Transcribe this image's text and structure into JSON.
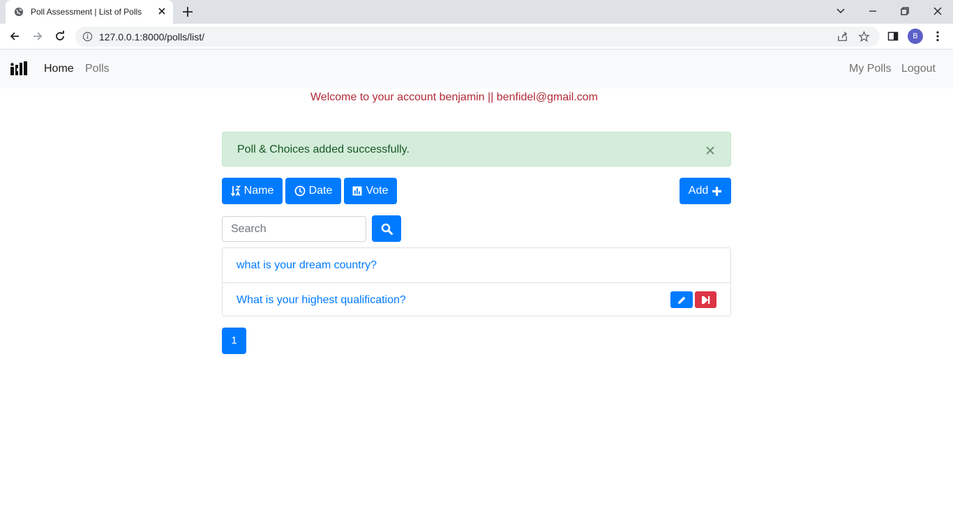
{
  "browser": {
    "tab_title": "Poll Assessment | List of Polls",
    "url": "127.0.0.1:8000/polls/list/",
    "profile_initial": "B"
  },
  "navbar": {
    "brand_icon": "logo-icon",
    "links": {
      "home": "Home",
      "polls": "Polls",
      "my_polls": "My Polls",
      "logout": "Logout"
    }
  },
  "welcome": "Welcome to your account benjamin || benfidel@gmail.com",
  "alert": {
    "message": "Poll & Choices added successfully."
  },
  "sort": {
    "name": "Name",
    "date": "Date",
    "vote": "Vote"
  },
  "add_label": "Add",
  "search": {
    "placeholder": "Search"
  },
  "polls": [
    {
      "question": "what is your dream country?"
    },
    {
      "question": "What is your highest qualification?"
    }
  ],
  "pagination": {
    "current": "1"
  },
  "colors": {
    "primary": "#007bff",
    "danger": "#dc3545",
    "success_bg": "#d4edda",
    "welcome_text": "#b02a37"
  }
}
